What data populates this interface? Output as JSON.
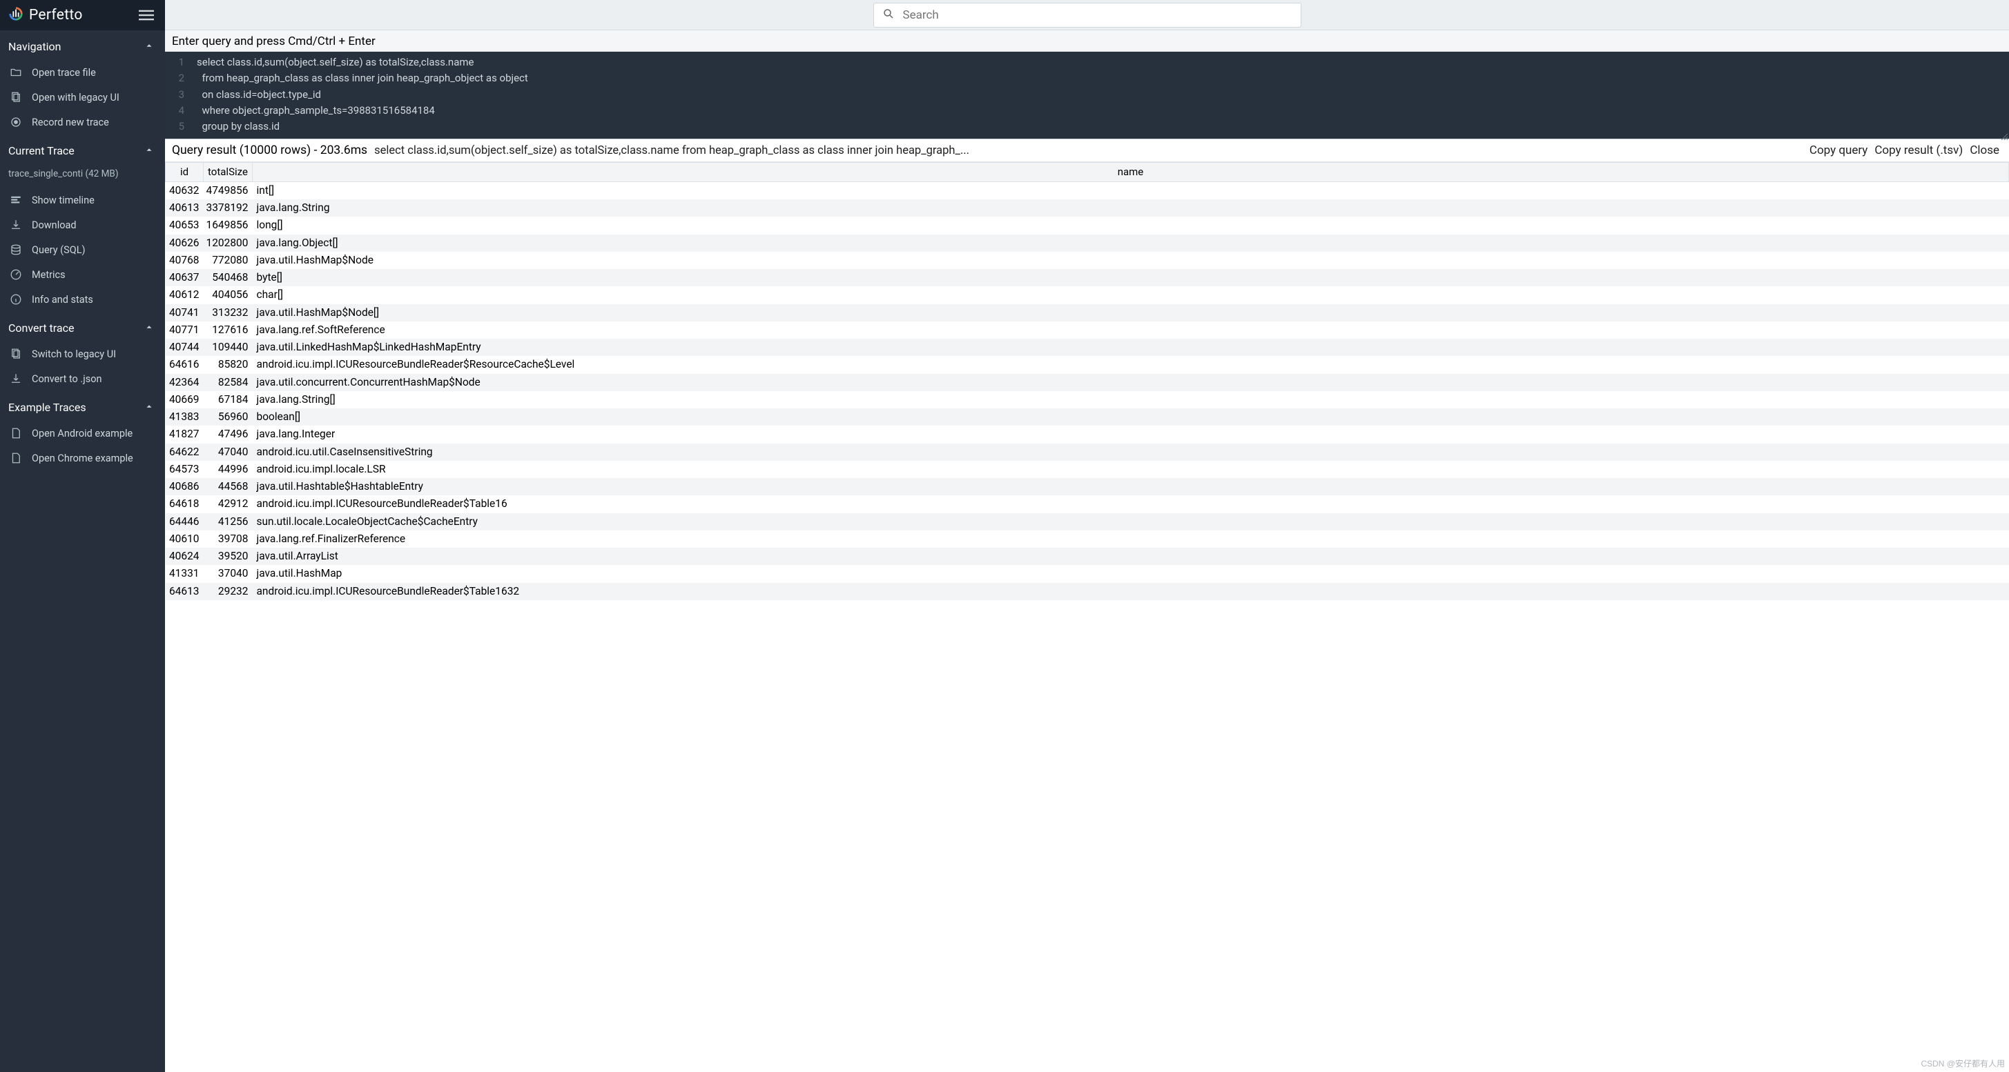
{
  "brand": "Perfetto",
  "search": {
    "placeholder": "Search"
  },
  "sidebar": {
    "sections": {
      "nav": {
        "title": "Navigation",
        "open_trace": "Open trace file",
        "open_legacy": "Open with legacy UI",
        "record": "Record new trace"
      },
      "current": {
        "title": "Current Trace",
        "trace_file": "trace_single_conti (42 MB)",
        "show_timeline": "Show timeline",
        "download": "Download",
        "query_sql": "Query (SQL)",
        "metrics": "Metrics",
        "info": "Info and stats"
      },
      "convert": {
        "title": "Convert trace",
        "switch_legacy": "Switch to legacy UI",
        "to_json": "Convert to .json"
      },
      "example": {
        "title": "Example Traces",
        "android": "Open Android example",
        "chrome": "Open Chrome example"
      }
    }
  },
  "editor": {
    "label": "Enter query and press Cmd/Ctrl + Enter",
    "lines": [
      "select class.id,sum(object.self_size) as totalSize,class.name",
      "  from heap_graph_class as class inner join heap_graph_object as object",
      "  on class.id=object.type_id",
      "  where object.graph_sample_ts=398831516584184",
      "  group by class.id"
    ]
  },
  "result_bar": {
    "title": "Query result (10000 rows) - 203.6ms",
    "sql": "select class.id,sum(object.self_size) as totalSize,class.name from heap_graph_class as class inner join heap_graph_...",
    "copy_query": "Copy query",
    "copy_tsv": "Copy result (.tsv)",
    "close": "Close"
  },
  "columns": {
    "id": "id",
    "totalSize": "totalSize",
    "name": "name"
  },
  "rows": [
    {
      "id": 40632,
      "totalSize": 4749856,
      "name": "int[]"
    },
    {
      "id": 40613,
      "totalSize": 3378192,
      "name": "java.lang.String"
    },
    {
      "id": 40653,
      "totalSize": 1649856,
      "name": "long[]"
    },
    {
      "id": 40626,
      "totalSize": 1202800,
      "name": "java.lang.Object[]"
    },
    {
      "id": 40768,
      "totalSize": 772080,
      "name": "java.util.HashMap$Node"
    },
    {
      "id": 40637,
      "totalSize": 540468,
      "name": "byte[]"
    },
    {
      "id": 40612,
      "totalSize": 404056,
      "name": "char[]"
    },
    {
      "id": 40741,
      "totalSize": 313232,
      "name": "java.util.HashMap$Node[]"
    },
    {
      "id": 40771,
      "totalSize": 127616,
      "name": "java.lang.ref.SoftReference"
    },
    {
      "id": 40744,
      "totalSize": 109440,
      "name": "java.util.LinkedHashMap$LinkedHashMapEntry"
    },
    {
      "id": 64616,
      "totalSize": 85820,
      "name": "android.icu.impl.ICUResourceBundleReader$ResourceCache$Level"
    },
    {
      "id": 42364,
      "totalSize": 82584,
      "name": "java.util.concurrent.ConcurrentHashMap$Node"
    },
    {
      "id": 40669,
      "totalSize": 67184,
      "name": "java.lang.String[]"
    },
    {
      "id": 41383,
      "totalSize": 56960,
      "name": "boolean[]"
    },
    {
      "id": 41827,
      "totalSize": 47496,
      "name": "java.lang.Integer"
    },
    {
      "id": 64622,
      "totalSize": 47040,
      "name": "android.icu.util.CaseInsensitiveString"
    },
    {
      "id": 64573,
      "totalSize": 44996,
      "name": "android.icu.impl.locale.LSR"
    },
    {
      "id": 40686,
      "totalSize": 44568,
      "name": "java.util.Hashtable$HashtableEntry"
    },
    {
      "id": 64618,
      "totalSize": 42912,
      "name": "android.icu.impl.ICUResourceBundleReader$Table16"
    },
    {
      "id": 64446,
      "totalSize": 41256,
      "name": "sun.util.locale.LocaleObjectCache$CacheEntry"
    },
    {
      "id": 40610,
      "totalSize": 39708,
      "name": "java.lang.ref.FinalizerReference"
    },
    {
      "id": 40624,
      "totalSize": 39520,
      "name": "java.util.ArrayList"
    },
    {
      "id": 41331,
      "totalSize": 37040,
      "name": "java.util.HashMap"
    },
    {
      "id": 64613,
      "totalSize": 29232,
      "name": "android.icu.impl.ICUResourceBundleReader$Table1632"
    }
  ],
  "watermark": "CSDN @安仔都有人用"
}
